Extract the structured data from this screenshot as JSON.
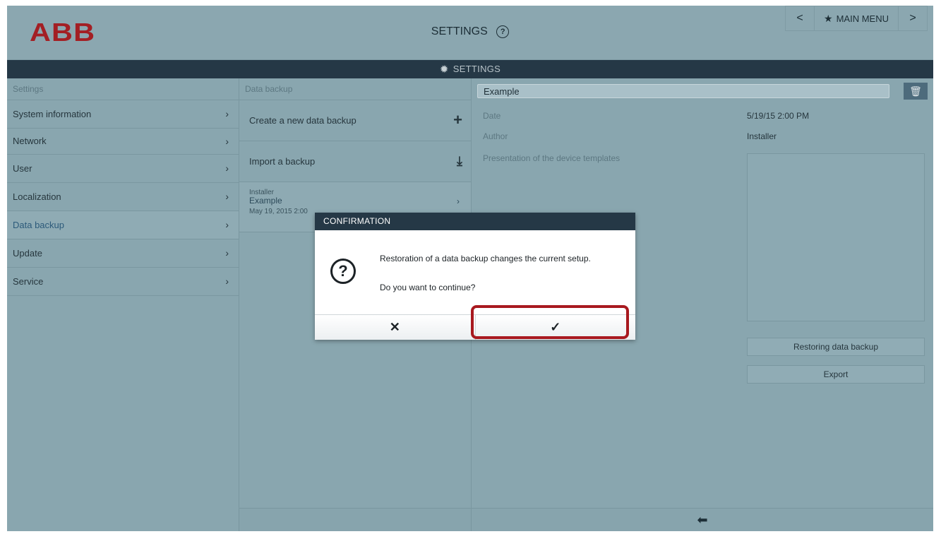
{
  "header": {
    "logo": "ABB",
    "title": "SETTINGS",
    "help_icon": "?",
    "nav_prev": "<",
    "main_menu": "MAIN MENU",
    "nav_next": ">"
  },
  "settings_bar": {
    "label": "SETTINGS"
  },
  "sidebar": {
    "heading": "Settings",
    "items": [
      {
        "label": "System information"
      },
      {
        "label": "Network"
      },
      {
        "label": "User"
      },
      {
        "label": "Localization"
      },
      {
        "label": "Data backup",
        "active": true
      },
      {
        "label": "Update"
      },
      {
        "label": "Service"
      }
    ]
  },
  "backup": {
    "heading": "Data backup",
    "create_label": "Create a new data backup",
    "import_label": "Import a backup",
    "entry": {
      "author": "Installer",
      "name": "Example",
      "date": "May 19, 2015 2:00"
    }
  },
  "detail": {
    "name_value": "Example",
    "date_label": "Date",
    "date_value": "5/19/15 2:00 PM",
    "author_label": "Author",
    "author_value": "Installer",
    "description_label": "Presentation of the device templates",
    "restore_button": "Restoring data backup",
    "export_button": "Export"
  },
  "dialog": {
    "title": "CONFIRMATION",
    "message1": "Restoration of a data backup changes the current setup.",
    "message2": "Do you want to continue?",
    "cancel_symbol": "✕",
    "confirm_symbol": "✓"
  },
  "colors": {
    "accent_red": "#a8191f",
    "dark_bar": "#253846",
    "logo_red": "#a31f24"
  }
}
